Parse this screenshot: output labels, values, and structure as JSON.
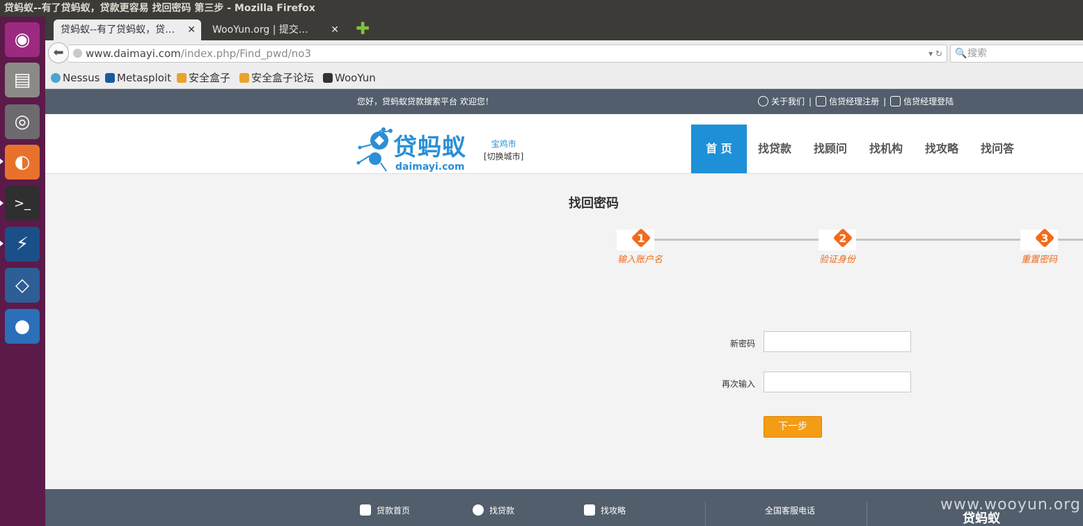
{
  "window": {
    "title": "贷蚂蚁--有了贷蚂蚁，贷款更容易 找回密码 第三步 - Mozilla Firefox"
  },
  "launcher": {
    "items": [
      {
        "name": "ubuntu-dash-icon",
        "glyph": "◉"
      },
      {
        "name": "files-icon",
        "glyph": "▤"
      },
      {
        "name": "chromium-icon",
        "glyph": "◎"
      },
      {
        "name": "firefox-icon",
        "glyph": "◐"
      },
      {
        "name": "terminal-icon",
        "glyph": ">_"
      },
      {
        "name": "zap-icon",
        "glyph": "⚡"
      },
      {
        "name": "virtualbox-icon",
        "glyph": "◇"
      },
      {
        "name": "qq-icon",
        "glyph": "●"
      }
    ]
  },
  "tabs": [
    {
      "label": "贷蚂蚁--有了贷蚂蚁，贷…",
      "close": "✕"
    },
    {
      "label": "WooYun.org | 提交…",
      "close": "✕"
    }
  ],
  "newtab_glyph": "✚",
  "nav": {
    "back_glyph": "⬅",
    "url_host": "www.daimayi.com",
    "url_path": "/index.php/Find_pwd/no3",
    "url_controls": "▾ ↻",
    "search_placeholder": "搜索",
    "search_glyph": "🔍"
  },
  "bookmarks": [
    {
      "label": "Nessus",
      "color": "#4fa3d1"
    },
    {
      "label": "Metasploit",
      "color": "#1a5a9c"
    },
    {
      "label": "安全盒子",
      "color": "#e8a32c"
    },
    {
      "label": "安全盒子论坛",
      "color": "#e8a32c"
    },
    {
      "label": "WooYun",
      "color": "#333333"
    }
  ],
  "site": {
    "welcome": "您好，贷蚂蚁贷款搜索平台 欢迎您！",
    "top_links": [
      "关于我们",
      "信贷经理注册",
      "信贷经理登陆"
    ],
    "top_sep": "|",
    "logo_cn": "贷蚂蚁",
    "logo_en": "daimayi.com",
    "city": "宝鸡市",
    "city_switch": "[切换城市]",
    "nav": [
      "首 页",
      "找贷款",
      "找顾问",
      "找机构",
      "找攻略",
      "找问答"
    ],
    "accent": "#1e90d8",
    "orange": "#f26a1b"
  },
  "form": {
    "title": "找回密码",
    "steps": [
      {
        "num": "1",
        "label": "输入账户名"
      },
      {
        "num": "2",
        "label": "验证身份"
      },
      {
        "num": "3",
        "label": "重置密码"
      }
    ],
    "new_password_label": "新密码",
    "confirm_label": "再次输入",
    "next_button": "下一步"
  },
  "footer": {
    "links": [
      "贷款首页",
      "找贷款",
      "找攻略"
    ],
    "hotline": "全国客服电话",
    "watermark": "www.wooyun.org",
    "logo": "贷蚂蚁"
  }
}
